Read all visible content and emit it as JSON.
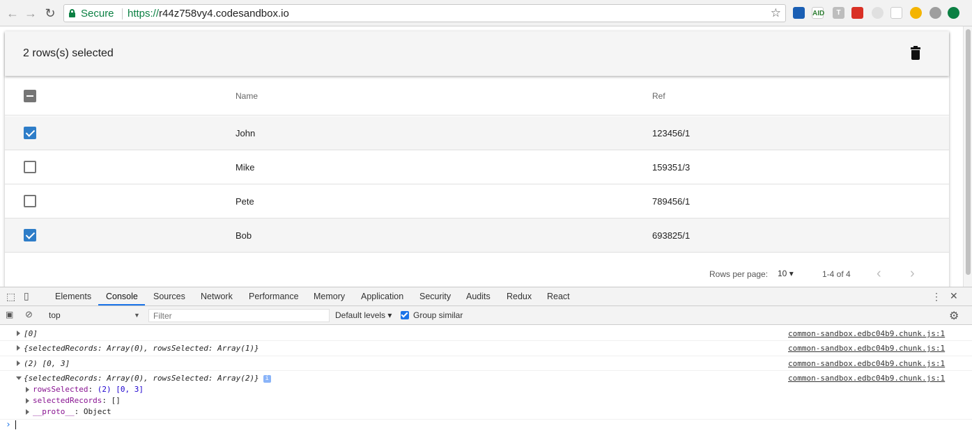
{
  "browser": {
    "secure_label": "Secure",
    "url_scheme": "https://",
    "url_host": "r44z758vy4.codesandbox.io",
    "back_glyph": "←",
    "forward_glyph": "→",
    "reload_glyph": "↻",
    "star_glyph": "☆",
    "extensions": [
      {
        "name": "person-x-extension-icon",
        "color": "#1a5fb4",
        "label": ""
      },
      {
        "name": "aid-extension-icon",
        "color": "#ffffff",
        "label": "AID"
      },
      {
        "name": "t-extension-icon",
        "color": "#bdbdbd",
        "label": "T"
      },
      {
        "name": "red-extension-icon",
        "color": "#d93025",
        "label": ""
      },
      {
        "name": "gray-circle-extension-icon",
        "color": "#e0e0e0",
        "label": ""
      },
      {
        "name": "crop-extension-icon",
        "color": "#ffffff",
        "label": ""
      },
      {
        "name": "color-picker-extension-icon",
        "color": "#f4b400",
        "label": ""
      },
      {
        "name": "toggle-extension-icon",
        "color": "#9e9e9e",
        "label": ""
      },
      {
        "name": "green-arrow-extension-icon",
        "color": "#0b8043",
        "label": ""
      }
    ]
  },
  "table": {
    "toolbar_title": "2 rows(s) selected",
    "columns": [
      "Name",
      "Ref"
    ],
    "rows": [
      {
        "name": "John",
        "ref": "123456/1",
        "selected": true
      },
      {
        "name": "Mike",
        "ref": "159351/3",
        "selected": false
      },
      {
        "name": "Pete",
        "ref": "789456/1",
        "selected": false
      },
      {
        "name": "Bob",
        "ref": "693825/1",
        "selected": true
      }
    ],
    "footer": {
      "rows_per_page_label": "Rows per page:",
      "rows_per_page_value": "10",
      "range": "1-4 of 4"
    }
  },
  "devtools": {
    "tabs": [
      "Elements",
      "Console",
      "Sources",
      "Network",
      "Performance",
      "Memory",
      "Application",
      "Security",
      "Audits",
      "Redux",
      "React"
    ],
    "active_tab": "Console",
    "context": "top",
    "filter_placeholder": "Filter",
    "levels_label": "Default levels ▾",
    "group_similar_label": "Group similar",
    "logs": [
      {
        "message": "[0]",
        "source": "common-sandbox.edbc04b9.chunk.js:1"
      },
      {
        "message": "{selectedRecords: Array(0), rowsSelected: Array(1)}",
        "source": "common-sandbox.edbc04b9.chunk.js:1"
      },
      {
        "message": "(2) [0, 3]",
        "source": "common-sandbox.edbc04b9.chunk.js:1"
      },
      {
        "message": "{selectedRecords: Array(0), rowsSelected: Array(2)}",
        "source": "common-sandbox.edbc04b9.chunk.js:1"
      }
    ],
    "expanded_props": [
      {
        "key": "rowsSelected",
        "value": "(2) [0, 3]"
      },
      {
        "key": "selectedRecords",
        "value": "[]"
      },
      {
        "key": "__proto__",
        "value": "Object"
      }
    ],
    "info_badge": "i",
    "prompt_glyph": "›"
  }
}
